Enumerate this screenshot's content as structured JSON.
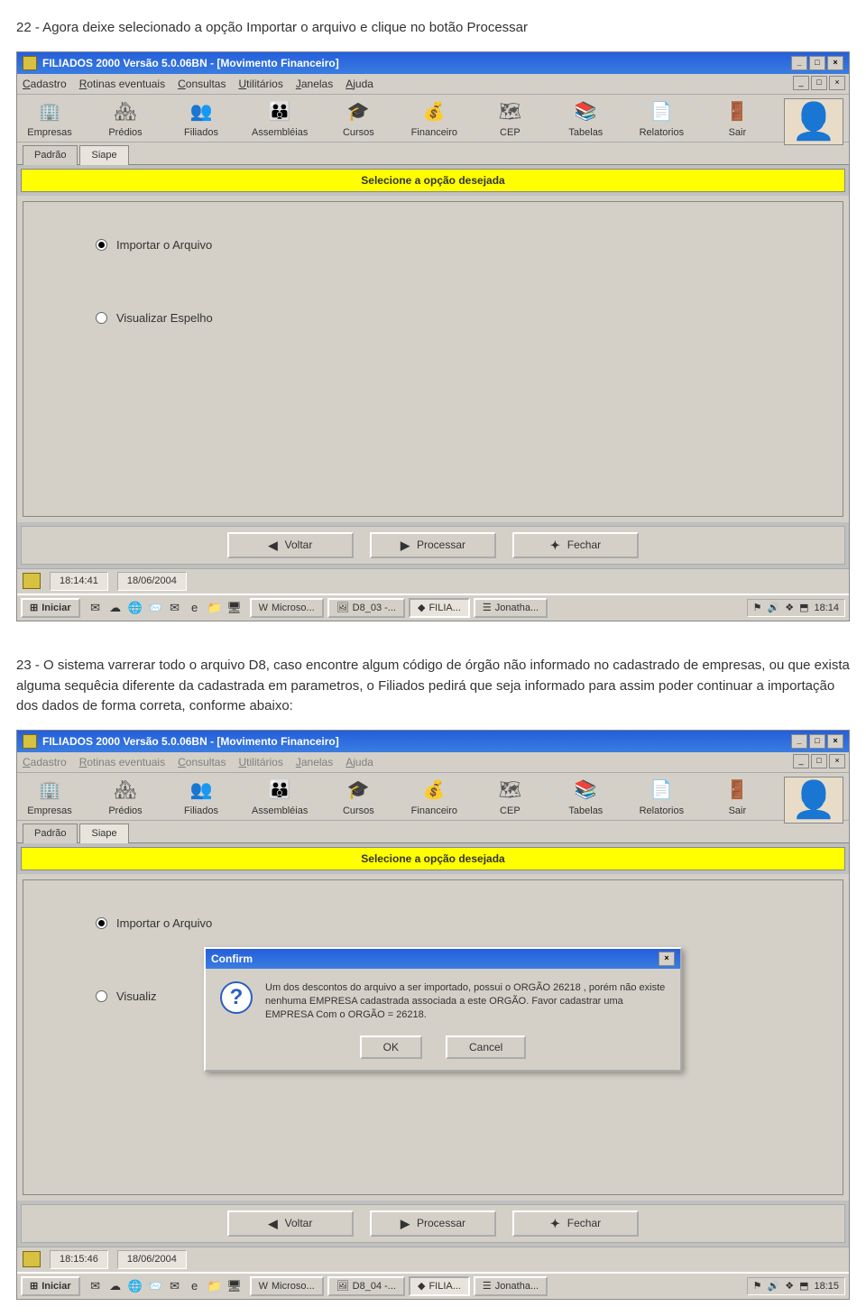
{
  "doc": {
    "step22": "22 - Agora deixe selecionado a opção Importar o arquivo e clique no botão Processar",
    "step23": "23 - O sistema varrerar todo o arquivo D8, caso encontre algum código de órgão não informado no cadastrado de empresas, ou que exista alguma sequêcia diferente da cadastrada em parametros, o Filiados pedirá que seja informado para assim poder continuar a importação dos dados de forma correta, conforme abaixo:"
  },
  "app": {
    "title": "FILIADOS 2000 Versão 5.0.06BN - [Movimento Financeiro]",
    "menus": [
      "Cadastro",
      "Rotinas eventuais",
      "Consultas",
      "Utilitários",
      "Janelas",
      "Ajuda"
    ],
    "toolbar": [
      {
        "icon": "🏢",
        "label": "Empresas"
      },
      {
        "icon": "🏘",
        "label": "Prédios"
      },
      {
        "icon": "👥",
        "label": "Filiados"
      },
      {
        "icon": "👪",
        "label": "Assembléias"
      },
      {
        "icon": "🎓",
        "label": "Cursos"
      },
      {
        "icon": "💰",
        "label": "Financeiro"
      },
      {
        "icon": "🗺",
        "label": "CEP"
      },
      {
        "icon": "📚",
        "label": "Tabelas"
      },
      {
        "icon": "📄",
        "label": "Relatorios"
      },
      {
        "icon": "🚪",
        "label": "Sair"
      }
    ],
    "tabs": [
      "Padrão",
      "Siape"
    ],
    "active_tab": 1,
    "yellow_header": "Selecione a opção desejada",
    "radios": {
      "opt1": "Importar o Arquivo",
      "opt2": "Visualizar Espelho",
      "opt2_trunc": "Visualiz"
    },
    "buttons": {
      "voltar_glyph": "◀",
      "voltar": "Voltar",
      "processar_glyph": "▶",
      "processar": "Processar",
      "fechar_glyph": "✦",
      "fechar": "Fechar"
    },
    "window_controls": {
      "min": "_",
      "max": "□",
      "close": "×"
    }
  },
  "status1": {
    "time": "18:14:41",
    "date": "18/06/2004"
  },
  "status2": {
    "time": "18:15:46",
    "date": "18/06/2004"
  },
  "taskbar": {
    "start": "Iniciar",
    "tasks1": [
      {
        "icon": "W",
        "label": "Microso..."
      },
      {
        "icon": "🖼",
        "label": "D8_03 -..."
      },
      {
        "icon": "◆",
        "label": "FILIA..."
      },
      {
        "icon": "☰",
        "label": "Jonatha..."
      }
    ],
    "tasks2": [
      {
        "icon": "W",
        "label": "Microso..."
      },
      {
        "icon": "🖼",
        "label": "D8_04 -..."
      },
      {
        "icon": "◆",
        "label": "FILIA..."
      },
      {
        "icon": "☰",
        "label": "Jonatha..."
      }
    ],
    "clock1": "18:14",
    "clock2": "18:15"
  },
  "confirm": {
    "title": "Confirm",
    "message": "Um dos descontos do arquivo a ser importado, possui o ORGÃO 26218 , porém não existe nenhuma EMPRESA cadastrada associada a este ORGÃO. Favor cadastrar uma EMPRESA Com o ORGÃO = 26218.",
    "ok": "OK",
    "cancel": "Cancel"
  }
}
